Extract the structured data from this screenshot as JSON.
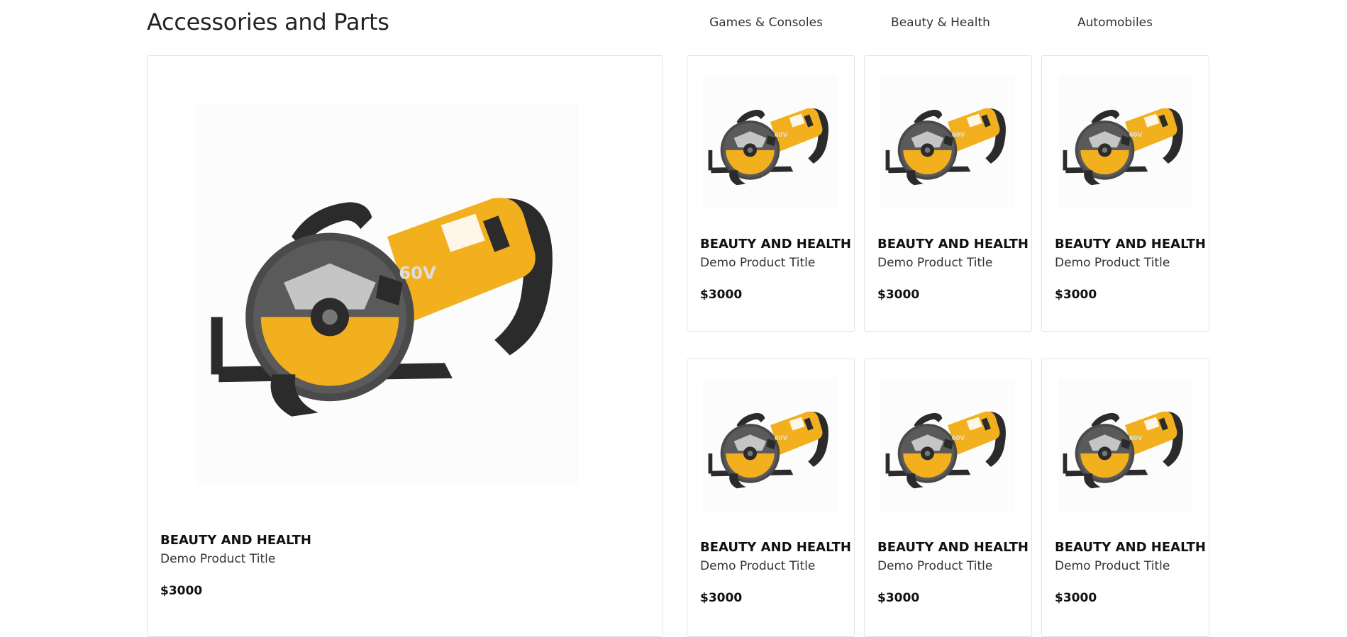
{
  "section": {
    "title": "Accessories and Parts",
    "tabs": [
      "Games & Consoles",
      "Beauty & Health",
      "Automobiles"
    ]
  },
  "featured": {
    "image": "circular-saw-image",
    "category": "BEAUTY AND HEALTH",
    "title": "Demo Product Title",
    "price": "$3000"
  },
  "products": [
    {
      "image": "circular-saw-image",
      "category": "BEAUTY AND HEALTH",
      "title": "Demo Product Title",
      "price": "$3000"
    },
    {
      "image": "circular-saw-image",
      "category": "BEAUTY AND HEALTH",
      "title": "Demo Product Title",
      "price": "$3000"
    },
    {
      "image": "circular-saw-image",
      "category": "BEAUTY AND HEALTH",
      "title": "Demo Product Title",
      "price": "$3000"
    },
    {
      "image": "circular-saw-image",
      "category": "BEAUTY AND HEALTH",
      "title": "Demo Product Title",
      "price": "$3000"
    },
    {
      "image": "circular-saw-image",
      "category": "BEAUTY AND HEALTH",
      "title": "Demo Product Title",
      "price": "$3000"
    },
    {
      "image": "circular-saw-image",
      "category": "BEAUTY AND HEALTH",
      "title": "Demo Product Title",
      "price": "$3000"
    }
  ],
  "colors": {
    "saw_yellow": "#f2b01e",
    "saw_dark": "#2b2b2b",
    "saw_grey": "#5a5a5a",
    "card_border": "#e2e2e2"
  }
}
